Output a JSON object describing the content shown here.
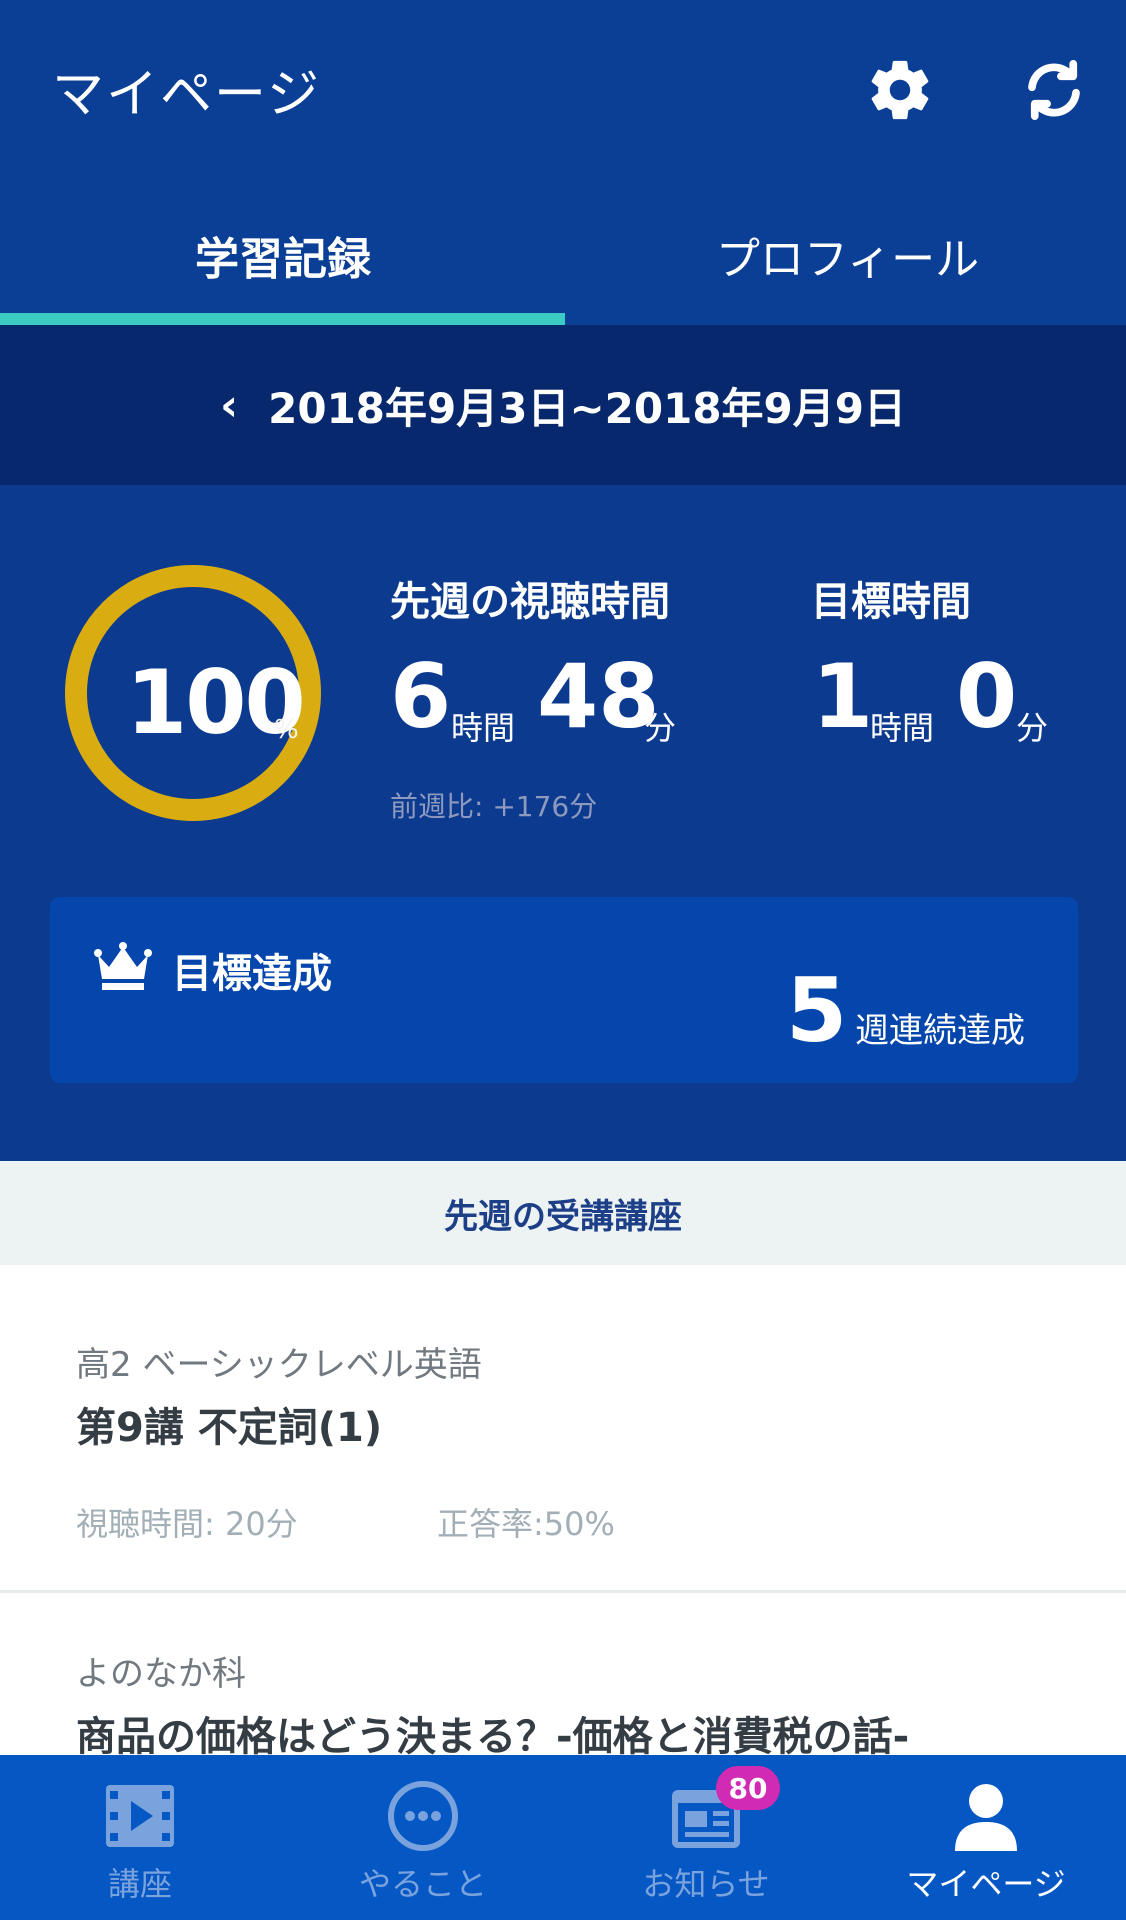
{
  "header": {
    "title": "マイページ",
    "settings_icon": "gear-icon",
    "refresh_icon": "refresh-icon"
  },
  "tabs": [
    {
      "label": "学習記録",
      "active": true
    },
    {
      "label": "プロフィール",
      "active": false
    }
  ],
  "date_range": {
    "prev_icon": "chevron-left-icon",
    "text": "2018年9月3日~2018年9月9日"
  },
  "summary": {
    "achievement_percent": "100",
    "achievement_unit": "%",
    "watch_label": "先週の視聴時間",
    "watch_hours": "6",
    "watch_minutes": "48",
    "goal_label": "目標時間",
    "goal_hours": "1",
    "goal_minutes": "0",
    "hour_unit": "時間",
    "minute_unit": "分",
    "compare_text": "前週比: +176分",
    "ring_color": "#d9ad12"
  },
  "achievement": {
    "icon": "crown-icon",
    "title": "目標達成",
    "streak_count": "5",
    "streak_text": "週連続達成"
  },
  "section": {
    "title": "先週の受講講座"
  },
  "lectures": [
    {
      "course": "高2 ベーシックレベル英語",
      "lesson": "第9講 不定詞(1)",
      "watch_time": "視聴時間: 20分",
      "accuracy": "正答率:50%"
    },
    {
      "course": "よのなか科",
      "lesson": "商品の価格はどう決まる？-価格と消費税の話-"
    }
  ],
  "nav": {
    "items": [
      {
        "label": "講座",
        "icon": "video-icon",
        "active": false
      },
      {
        "label": "やること",
        "icon": "more-dots-icon",
        "active": false
      },
      {
        "label": "お知らせ",
        "icon": "news-icon",
        "active": false
      },
      {
        "label": "マイページ",
        "icon": "user-icon",
        "active": true
      }
    ],
    "badge": "80"
  },
  "colors": {
    "header": "#0b3f96",
    "accent": "#3ccbc3",
    "navbar": "#0557c4",
    "badge": "#d12bb3"
  }
}
